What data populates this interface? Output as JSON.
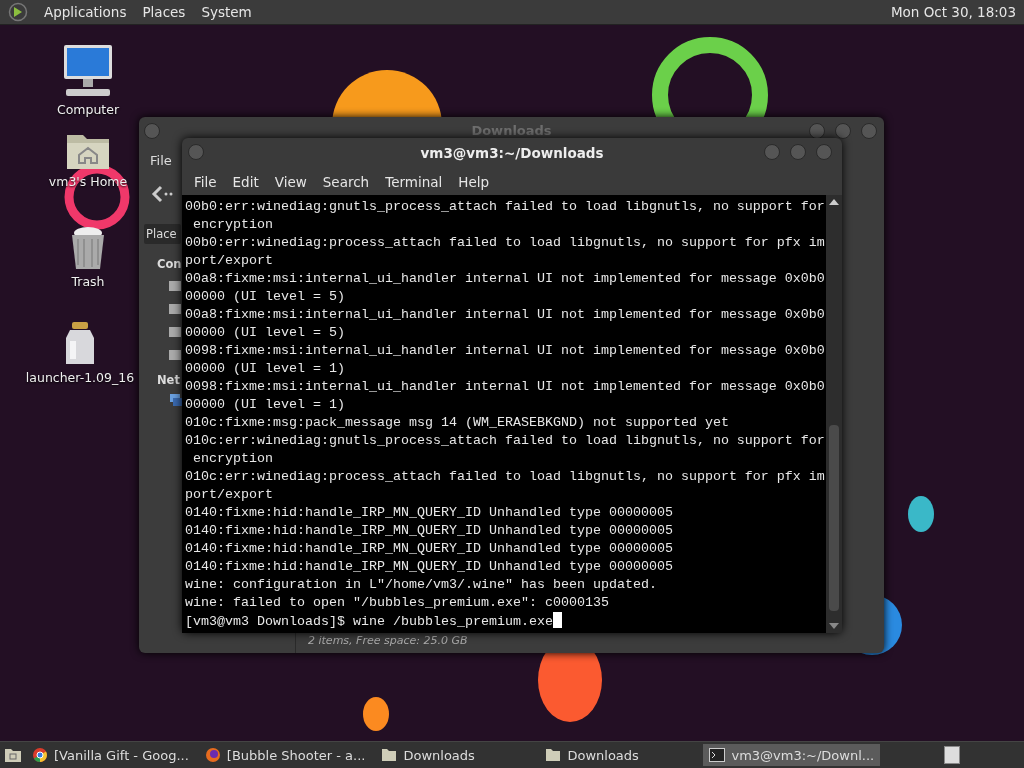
{
  "top_panel": {
    "menus": [
      "Applications",
      "Places",
      "System"
    ],
    "clock": "Mon Oct 30, 18:03"
  },
  "desktop_icons": [
    {
      "kind": "computer",
      "label": "Computer"
    },
    {
      "kind": "home",
      "label": "vm3's Home"
    },
    {
      "kind": "trash",
      "label": "Trash"
    },
    {
      "kind": "jar",
      "label": "launcher-1.09_16"
    }
  ],
  "file_manager": {
    "title": "Downloads",
    "menu": "File",
    "places_button": "Place",
    "sections": [
      "Con",
      "Net"
    ],
    "status": "2 items, Free space: 25.0 GB"
  },
  "terminal": {
    "title": "vm3@vm3:~/Downloads",
    "menus": [
      "File",
      "Edit",
      "View",
      "Search",
      "Terminal",
      "Help"
    ],
    "lines": [
      "00b0:err:winediag:gnutls_process_attach failed to load libgnutls, no support for",
      " encryption",
      "00b0:err:winediag:process_attach failed to load libgnutls, no support for pfx im",
      "port/export",
      "00a8:fixme:msi:internal_ui_handler internal UI not implemented for message 0x0b0",
      "00000 (UI level = 5)",
      "00a8:fixme:msi:internal_ui_handler internal UI not implemented for message 0x0b0",
      "00000 (UI level = 5)",
      "0098:fixme:msi:internal_ui_handler internal UI not implemented for message 0x0b0",
      "00000 (UI level = 1)",
      "0098:fixme:msi:internal_ui_handler internal UI not implemented for message 0x0b0",
      "00000 (UI level = 1)",
      "010c:fixme:msg:pack_message msg 14 (WM_ERASEBKGND) not supported yet",
      "010c:err:winediag:gnutls_process_attach failed to load libgnutls, no support for",
      " encryption",
      "010c:err:winediag:process_attach failed to load libgnutls, no support for pfx im",
      "port/export",
      "0140:fixme:hid:handle_IRP_MN_QUERY_ID Unhandled type 00000005",
      "0140:fixme:hid:handle_IRP_MN_QUERY_ID Unhandled type 00000005",
      "0140:fixme:hid:handle_IRP_MN_QUERY_ID Unhandled type 00000005",
      "0140:fixme:hid:handle_IRP_MN_QUERY_ID Unhandled type 00000005",
      "wine: configuration in L\"/home/vm3/.wine\" has been updated.",
      "wine: failed to open \"/bubbles_premium.exe\": c0000135"
    ],
    "prompt": "[vm3@vm3 Downloads]$ wine /bubbles_premium.exe"
  },
  "taskbar": {
    "tasks": [
      {
        "kind": "chrome",
        "label": "[Vanilla Gift - Goog...",
        "selected": false
      },
      {
        "kind": "firefox",
        "label": "[Bubble Shooter - a...",
        "selected": false
      },
      {
        "kind": "folder",
        "label": "Downloads",
        "selected": false
      },
      {
        "kind": "folder",
        "label": "Downloads",
        "selected": false
      },
      {
        "kind": "terminal",
        "label": "vm3@vm3:~/Downl...",
        "selected": true
      }
    ]
  }
}
